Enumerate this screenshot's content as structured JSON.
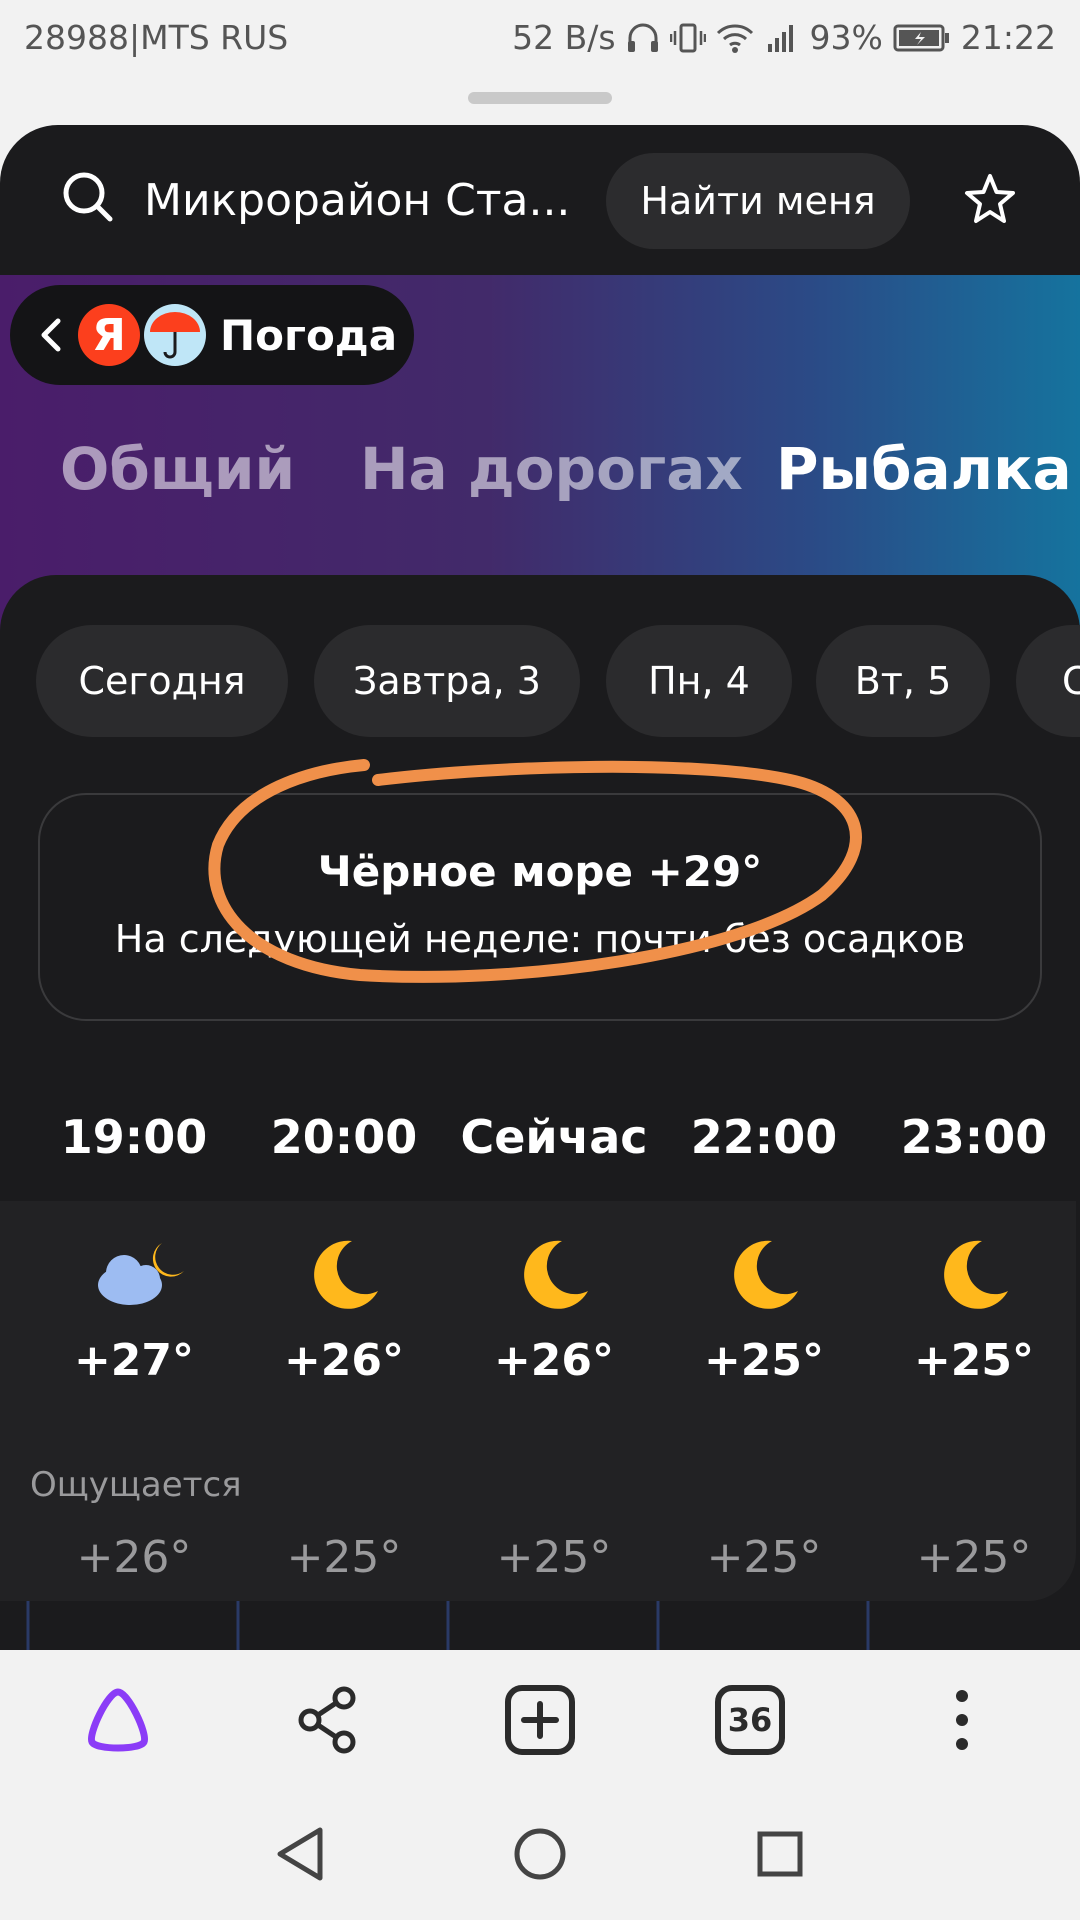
{
  "status_bar": {
    "carrier": "28988|MTS RUS",
    "net_speed": "52 B/s",
    "battery": "93%",
    "time": "21:22"
  },
  "header": {
    "search_text": "Микрорайон Ста...",
    "find_me_label": "Найти меня"
  },
  "brand": {
    "ya_letter": "Я",
    "title": "Погода"
  },
  "tabs": [
    {
      "label": "Общий"
    },
    {
      "label": "На дорогах"
    },
    {
      "label": "Рыбалка",
      "active": true
    }
  ],
  "day_chips": [
    {
      "label": "Сегодня"
    },
    {
      "label": "Завтра, 3"
    },
    {
      "label": "Пн, 4"
    },
    {
      "label": "Вт, 5"
    },
    {
      "label": "С"
    }
  ],
  "sea_card": {
    "title": "Чёрное море +29°",
    "subtitle": "На следующей неделе: почти без осадков"
  },
  "hourly": {
    "feels_label": "Ощущается",
    "items": [
      {
        "time": "19:00",
        "icon": "partly-cloudy-night-icon",
        "temp": "+27°",
        "feels": "+26°"
      },
      {
        "time": "20:00",
        "icon": "moon-icon",
        "temp": "+26°",
        "feels": "+25°"
      },
      {
        "time": "Сейчас",
        "icon": "moon-icon",
        "temp": "+26°",
        "feels": "+25°"
      },
      {
        "time": "22:00",
        "icon": "moon-icon",
        "temp": "+25°",
        "feels": "+25°"
      },
      {
        "time": "23:00",
        "icon": "moon-icon",
        "temp": "+25°",
        "feels": "+25°"
      }
    ]
  },
  "toolbar": {
    "tabs_count": "36",
    "icons": [
      "alice-icon",
      "share-icon",
      "new-tab-icon",
      "tabs-counter-icon",
      "more-icon"
    ]
  },
  "colors": {
    "sheet_bg": "#1b1b1d",
    "annotation": "#f0904a",
    "ya_red": "#fc3f1d",
    "moon": "#ffb81c",
    "alice_purple": "#8b3cf7"
  }
}
